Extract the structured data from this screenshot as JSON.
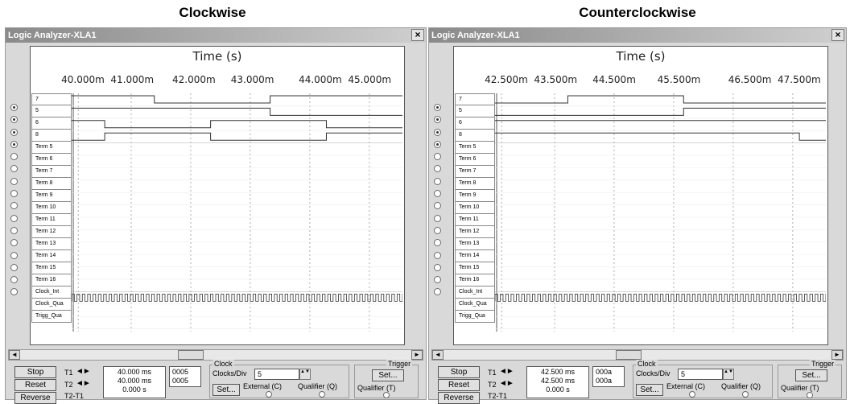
{
  "captions": {
    "left": "Clockwise",
    "right": "Counterclockwise"
  },
  "panels": [
    {
      "id": "cw",
      "title": "Logic Analyzer-XLA1",
      "close_label": "×",
      "axis_title": "Time (s)",
      "ticks": [
        "40.000m",
        "41.000m",
        "42.000m",
        "43.000m",
        "44.000m",
        "45.000m"
      ],
      "channels": [
        "7",
        "5",
        "6",
        "8",
        "Term 5",
        "Term 6",
        "Term 7",
        "Term 8",
        "Term 9",
        "Term 10",
        "Term 11",
        "Term 12",
        "Term 13",
        "Term 14",
        "Term 15",
        "Term 16",
        "Clock_Int",
        "Clock_Qua",
        "Trigg_Qua"
      ],
      "radio_on_count": 4,
      "waves": {
        "7": [
          [
            0,
            1
          ],
          [
            0.25,
            0
          ],
          [
            0.6,
            1
          ],
          [
            1.0,
            1
          ]
        ],
        "5": [
          [
            0,
            1
          ],
          [
            0.6,
            0
          ],
          [
            1.0,
            0
          ]
        ],
        "6": [
          [
            0,
            1
          ],
          [
            0.1,
            0
          ],
          [
            0.42,
            1
          ],
          [
            0.77,
            0
          ],
          [
            1.0,
            0
          ]
        ],
        "8": [
          [
            0,
            0
          ],
          [
            0.1,
            1
          ],
          [
            0.42,
            0
          ],
          [
            0.77,
            1
          ],
          [
            1.0,
            1
          ]
        ]
      },
      "buttons": {
        "stop": "Stop",
        "reset": "Reset",
        "reverse": "Reverse"
      },
      "cursor": {
        "t1_label": "T1",
        "t2_label": "T2",
        "t2t1_label": "T2-T1",
        "t1_value": "40.000 ms",
        "t2_value": "40.000 ms",
        "diff_value": "0.000 s",
        "t1_hex": "0005",
        "t2_hex": "0005"
      },
      "clock": {
        "group_label": "Clock",
        "clocks_div_label": "Clocks/Div",
        "clocks_div_value": "5",
        "set_label": "Set...",
        "external_label": "External (C)",
        "qualifier_label": "Qualifier (Q)"
      },
      "trigger": {
        "group_label": "Trigger",
        "set_label": "Set...",
        "qualifier_label": "Qualifier (T)"
      },
      "scroll": {
        "left": "◄",
        "right": "►"
      }
    },
    {
      "id": "ccw",
      "title": "Logic Analyzer-XLA1",
      "close_label": "×",
      "axis_title": "Time (s)",
      "ticks": [
        "42.500m",
        "43.500m",
        "44.500m",
        "45.500m",
        "46.500m",
        "47.500m"
      ],
      "channels": [
        "7",
        "5",
        "6",
        "8",
        "Term 5",
        "Term 6",
        "Term 7",
        "Term 8",
        "Term 9",
        "Term 10",
        "Term 11",
        "Term 12",
        "Term 13",
        "Term 14",
        "Term 15",
        "Term 16",
        "Clock_Int",
        "Clock_Qua",
        "Trigg_Qua"
      ],
      "radio_on_count": 4,
      "waves": {
        "7": [
          [
            0,
            0
          ],
          [
            0.22,
            1
          ],
          [
            0.57,
            0
          ],
          [
            1.0,
            0
          ]
        ],
        "5": [
          [
            0,
            0
          ],
          [
            0.22,
            0
          ],
          [
            0.57,
            1
          ],
          [
            1.0,
            1
          ]
        ],
        "6": [
          [
            0,
            1
          ],
          [
            0.92,
            1
          ],
          [
            1.0,
            1
          ]
        ],
        "8": [
          [
            0,
            1
          ],
          [
            0.92,
            0
          ],
          [
            1.0,
            0
          ]
        ]
      },
      "buttons": {
        "stop": "Stop",
        "reset": "Reset",
        "reverse": "Reverse"
      },
      "cursor": {
        "t1_label": "T1",
        "t2_label": "T2",
        "t2t1_label": "T2-T1",
        "t1_value": "42.500 ms",
        "t2_value": "42.500 ms",
        "diff_value": "0.000 s",
        "t1_hex": "000a",
        "t2_hex": "000a"
      },
      "clock": {
        "group_label": "Clock",
        "clocks_div_label": "Clocks/Div",
        "clocks_div_value": "5",
        "set_label": "Set...",
        "external_label": "External (C)",
        "qualifier_label": "Qualifier (Q)"
      },
      "trigger": {
        "group_label": "Trigger",
        "set_label": "Set...",
        "qualifier_label": "Qualifier (T)"
      },
      "scroll": {
        "left": "◄",
        "right": "►"
      }
    }
  ]
}
